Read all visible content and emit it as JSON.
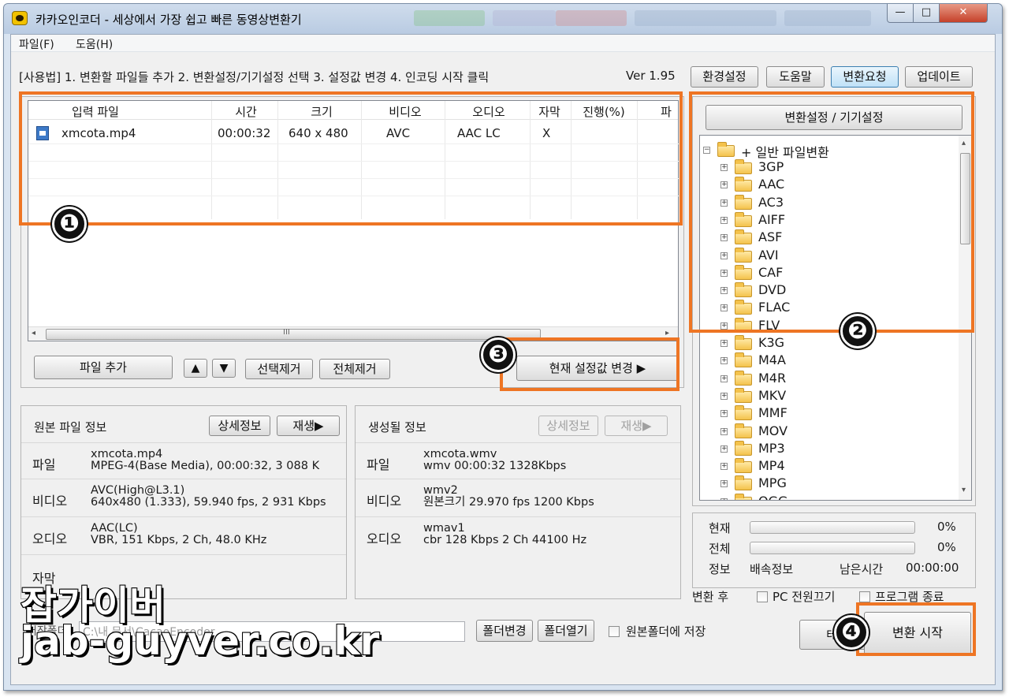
{
  "window": {
    "title": "카카오인코더 - 세상에서 가장 쉽고 빠른 동영상변환기"
  },
  "menu": [
    "파일(F)",
    "도움(H)"
  ],
  "toolbar": {
    "usage_text": "[사용법] 1. 변환할 파일들 추가   2. 변환설정/기기설정 선택   3. 설정값 변경   4. 인코딩 시작 클릭",
    "version": "Ver 1.95",
    "buttons": [
      "환경설정",
      "도움말",
      "변환요청",
      "업데이트"
    ]
  },
  "file_list": {
    "columns": [
      "입력 파일",
      "시간",
      "크기",
      "비디오",
      "오디오",
      "자막",
      "진행(%)",
      "파"
    ],
    "rows": [
      {
        "file": "xmcota.mp4",
        "time": "00:00:32",
        "size": "640 x 480",
        "video": "AVC",
        "audio": "AAC LC",
        "subtitle": "X",
        "progress": ""
      }
    ],
    "scroll_grip": "III"
  },
  "list_buttons": {
    "add": "파일 추가",
    "up": "▲",
    "down": "▼",
    "remove_selected": "선택제거",
    "remove_all": "전체제거",
    "change_settings": "현재 설정값 변경 ▶"
  },
  "source_info": {
    "title": "원본 파일 정보",
    "detail_btn": "상세정보",
    "play_btn": "재생▶",
    "rows": [
      {
        "label": "파일",
        "line1": "xmcota.mp4",
        "line2": "MPEG-4(Base Media), 00:00:32, 3 088 K"
      },
      {
        "label": "비디오",
        "line1": "AVC(High@L3.1)",
        "line2": "640x480 (1.333), 59.940 fps, 2 931 Kbps"
      },
      {
        "label": "오디오",
        "line1": "AAC(LC)",
        "line2": "VBR, 151 Kbps, 2 Ch, 48.0 KHz"
      },
      {
        "label": "자막",
        "line1": "",
        "line2": ""
      }
    ]
  },
  "output_info": {
    "title": "생성될 정보",
    "detail_btn": "상세정보",
    "play_btn": "재생▶",
    "rows": [
      {
        "label": "파일",
        "line1": "xmcota.wmv",
        "line2": "wmv  00:00:32  1328Kbps"
      },
      {
        "label": "비디오",
        "line1": "wmv2",
        "line2": "원본크기  29.970 fps  1200 Kbps"
      },
      {
        "label": "오디오",
        "line1": "wmav1",
        "line2": "cbr   128 Kbps  2 Ch  44100 Hz"
      }
    ]
  },
  "settings_panel": {
    "header": "변환설정 / 기기설정",
    "root": "+ 일반 파일변환",
    "formats": [
      "3GP",
      "AAC",
      "AC3",
      "AIFF",
      "ASF",
      "AVI",
      "CAF",
      "DVD",
      "FLAC",
      "FLV",
      "K3G",
      "M4A",
      "M4R",
      "MKV",
      "MMF",
      "MOV",
      "MP3",
      "MP4",
      "MPG",
      "OGG"
    ]
  },
  "progress": {
    "current_label": "현재",
    "current_value": 0,
    "current_text": "0%",
    "total_label": "전체",
    "total_value": 0,
    "total_text": "0%",
    "info_label": "정보",
    "speed_label": "배속정보",
    "remaining_label": "남은시간",
    "remaining_value": "00:00:00"
  },
  "after_convert": {
    "label": "변환 후",
    "pc_off": "PC 전원끄기",
    "exit_program": "프로그램 종료"
  },
  "output_folder": {
    "label": "저장폴더",
    "path": "C:\\내 문서\\CacaoEncoder",
    "change_btn": "폴더변경",
    "open_btn": "폴더열기",
    "save_to_source": "원본폴더에 저장"
  },
  "action_buttons": {
    "test": "테스트",
    "start": "변환 시작"
  },
  "annotations": {
    "badge1": "❶",
    "badge2": "❷",
    "badge3": "❸",
    "badge4": "❹",
    "accent": "#ee7524"
  },
  "watermark": {
    "line1": "잡가이버",
    "line2": "jab-guyver.co.kr"
  }
}
